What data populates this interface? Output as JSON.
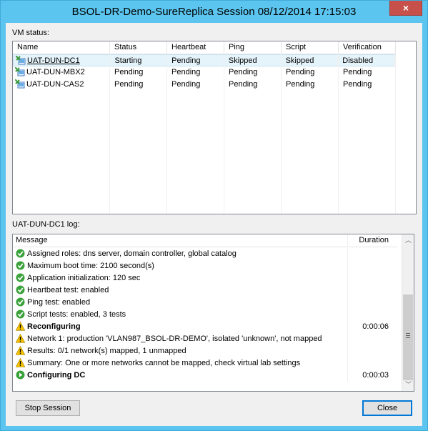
{
  "window": {
    "title": "BSOL-DR-Demo-SureReplica Session 08/12/2014 17:15:03",
    "close_glyph": "×",
    "accent_color": "#5bc5ef",
    "close_color": "#c7504a"
  },
  "vm_status": {
    "label": "VM status:",
    "columns": [
      "Name",
      "Status",
      "Heartbeat",
      "Ping",
      "Script",
      "Verification"
    ],
    "rows": [
      {
        "name": "UAT-DUN-DC1",
        "status": "Starting",
        "heartbeat": "Pending",
        "ping": "Skipped",
        "script": "Skipped",
        "verification": "Disabled",
        "selected": true,
        "icon": "vm-icon"
      },
      {
        "name": "UAT-DUN-MBX2",
        "status": "Pending",
        "heartbeat": "Pending",
        "ping": "Pending",
        "script": "Pending",
        "verification": "Pending",
        "selected": false,
        "icon": "vm-icon"
      },
      {
        "name": "UAT-DUN-CAS2",
        "status": "Pending",
        "heartbeat": "Pending",
        "ping": "Pending",
        "script": "Pending",
        "verification": "Pending",
        "selected": false,
        "icon": "vm-icon"
      }
    ]
  },
  "log": {
    "label": "UAT-DUN-DC1 log:",
    "columns": [
      "Message",
      "Duration"
    ],
    "rows": [
      {
        "icon": "success-icon",
        "message": "Assigned roles: dns server, domain controller, global catalog",
        "duration": "",
        "bold": false
      },
      {
        "icon": "success-icon",
        "message": "Maximum boot time: 2100 second(s)",
        "duration": "",
        "bold": false
      },
      {
        "icon": "success-icon",
        "message": "Application initialization: 120 sec",
        "duration": "",
        "bold": false
      },
      {
        "icon": "success-icon",
        "message": "Heartbeat test: enabled",
        "duration": "",
        "bold": false
      },
      {
        "icon": "success-icon",
        "message": "Ping test: enabled",
        "duration": "",
        "bold": false
      },
      {
        "icon": "success-icon",
        "message": "Script tests: enabled, 3 tests",
        "duration": "",
        "bold": false
      },
      {
        "icon": "warning-icon",
        "message": "Reconfiguring",
        "duration": "0:00:06",
        "bold": true
      },
      {
        "icon": "warning-icon",
        "message": "Network 1: production 'VLAN987_BSOL-DR-DEMO', isolated 'unknown', not mapped",
        "duration": "",
        "bold": false
      },
      {
        "icon": "warning-icon",
        "message": "Results: 0/1 network(s) mapped, 1 unmapped",
        "duration": "",
        "bold": false
      },
      {
        "icon": "warning-icon",
        "message": "Summary: One or more networks cannot be mapped, check virtual lab settings",
        "duration": "",
        "bold": false
      },
      {
        "icon": "running-icon",
        "message": "Configuring DC",
        "duration": "0:00:03",
        "bold": true
      }
    ]
  },
  "buttons": {
    "stop_session": "Stop Session",
    "close": "Close"
  },
  "scrollbar": {
    "up_glyph": "︿",
    "down_glyph": "﹀"
  }
}
